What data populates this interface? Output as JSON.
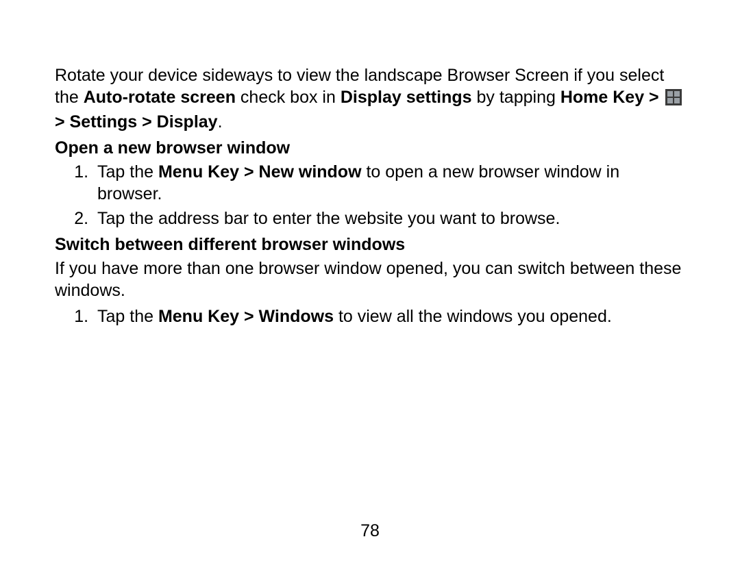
{
  "intro": {
    "t1": "Rotate your device sideways to view the landscape Browser Screen if you select the ",
    "b1": "Auto-rotate screen",
    "t2": " check box in ",
    "b2": "Display settings",
    "t3": " by tapping ",
    "b3": "Home Key > ",
    "b4": " > Settings > Display",
    "t4": "."
  },
  "section1": {
    "heading": "Open a new browser window",
    "item1": {
      "t1": "Tap the ",
      "b1": "Menu Key > New window",
      "t2": " to open a new browser window in browser."
    },
    "item2": {
      "t1": "Tap the address bar to enter the website you want to browse."
    }
  },
  "section2": {
    "heading": "Switch between different browser windows",
    "para": "If you have more than one browser window opened, you can switch between these windows.",
    "item1": {
      "t1": "Tap the ",
      "b1": "Menu Key > Windows",
      "t2": " to view all the windows you opened."
    }
  },
  "page_number": "78"
}
